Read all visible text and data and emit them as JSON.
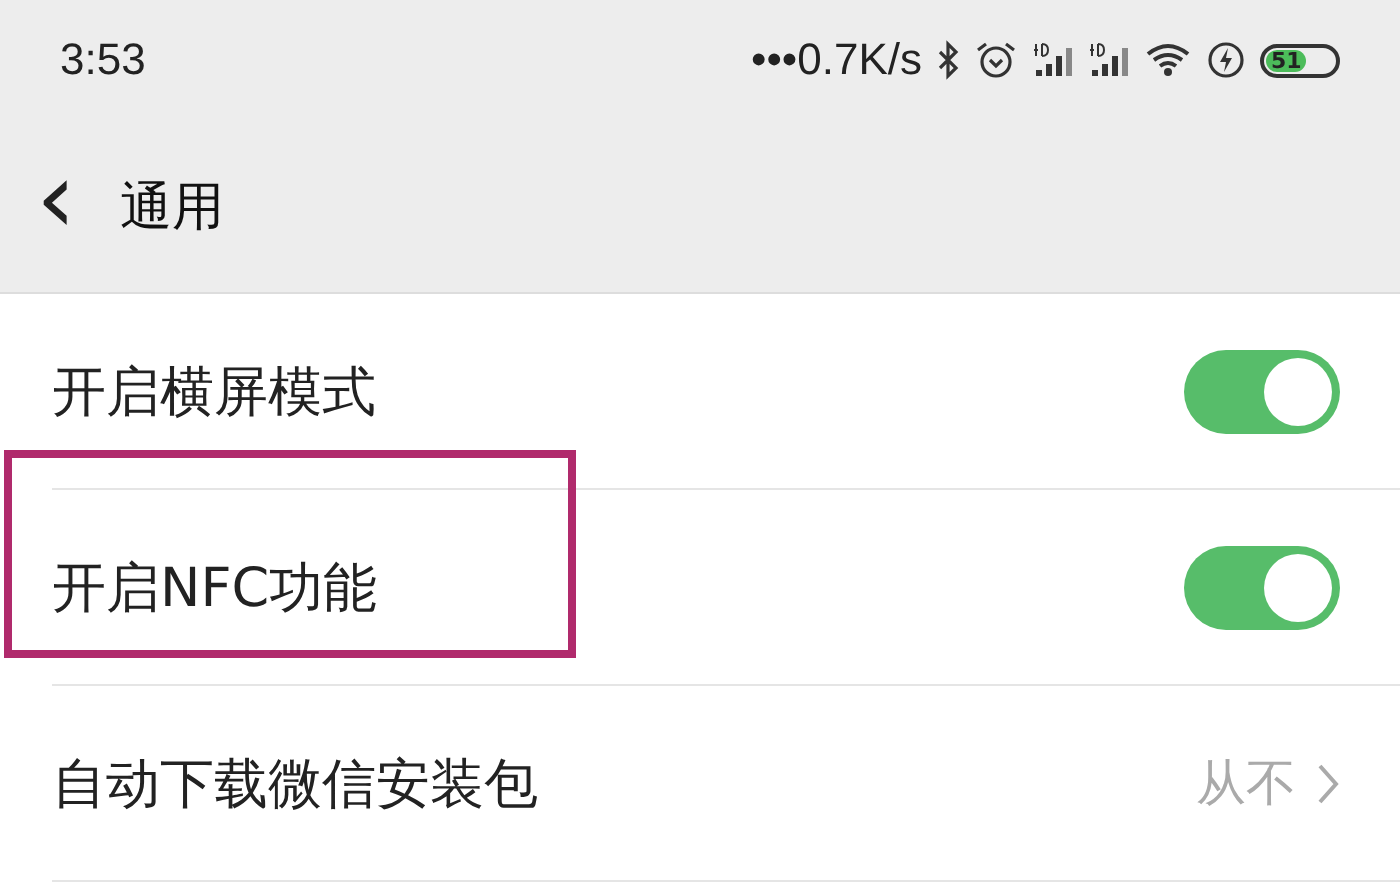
{
  "status_bar": {
    "time": "3:53",
    "speed": "•••0.7K/s",
    "battery": "51"
  },
  "header": {
    "back": "‹",
    "title": "通用"
  },
  "items": [
    {
      "kind": "toggle",
      "label": "开启横屏模式",
      "on": true
    },
    {
      "kind": "toggle",
      "label": "开启NFC功能",
      "on": true,
      "highlighted": true
    },
    {
      "kind": "link",
      "label": "自动下载微信安装包",
      "value": "从不"
    }
  ]
}
